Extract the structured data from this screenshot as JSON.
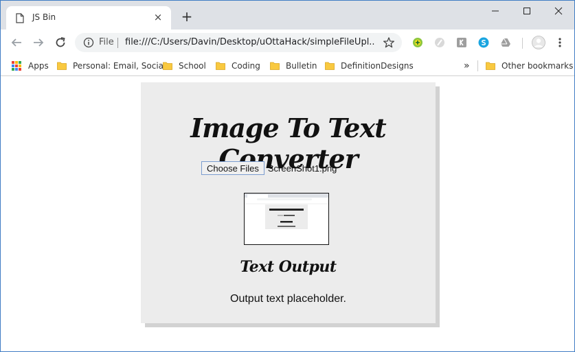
{
  "browser": {
    "tab_title": "JS Bin",
    "new_tab_symbol": "+",
    "close_symbol": "×",
    "omnibox": {
      "scheme": "File",
      "url": "file:///C:/Users/Davin/Desktop/uOttaHack/simpleFileUpl..."
    }
  },
  "bookmarks": {
    "apps_label": "Apps",
    "items": [
      {
        "label": "Personal: Email, Socia"
      },
      {
        "label": "School"
      },
      {
        "label": "Coding"
      },
      {
        "label": "Bulletin"
      },
      {
        "label": "DefinitionDesigns"
      }
    ],
    "overflow_symbol": "»",
    "other_label": "Other bookmarks",
    "folder_color": "#f9c940"
  },
  "page": {
    "title": "Image To Text Converter",
    "choose_button_label": "Choose Files",
    "file_name": "ScreenShot1.png",
    "subtitle": "Text Output",
    "output_text": "Output text placeholder.",
    "card_color": "#ececec"
  }
}
